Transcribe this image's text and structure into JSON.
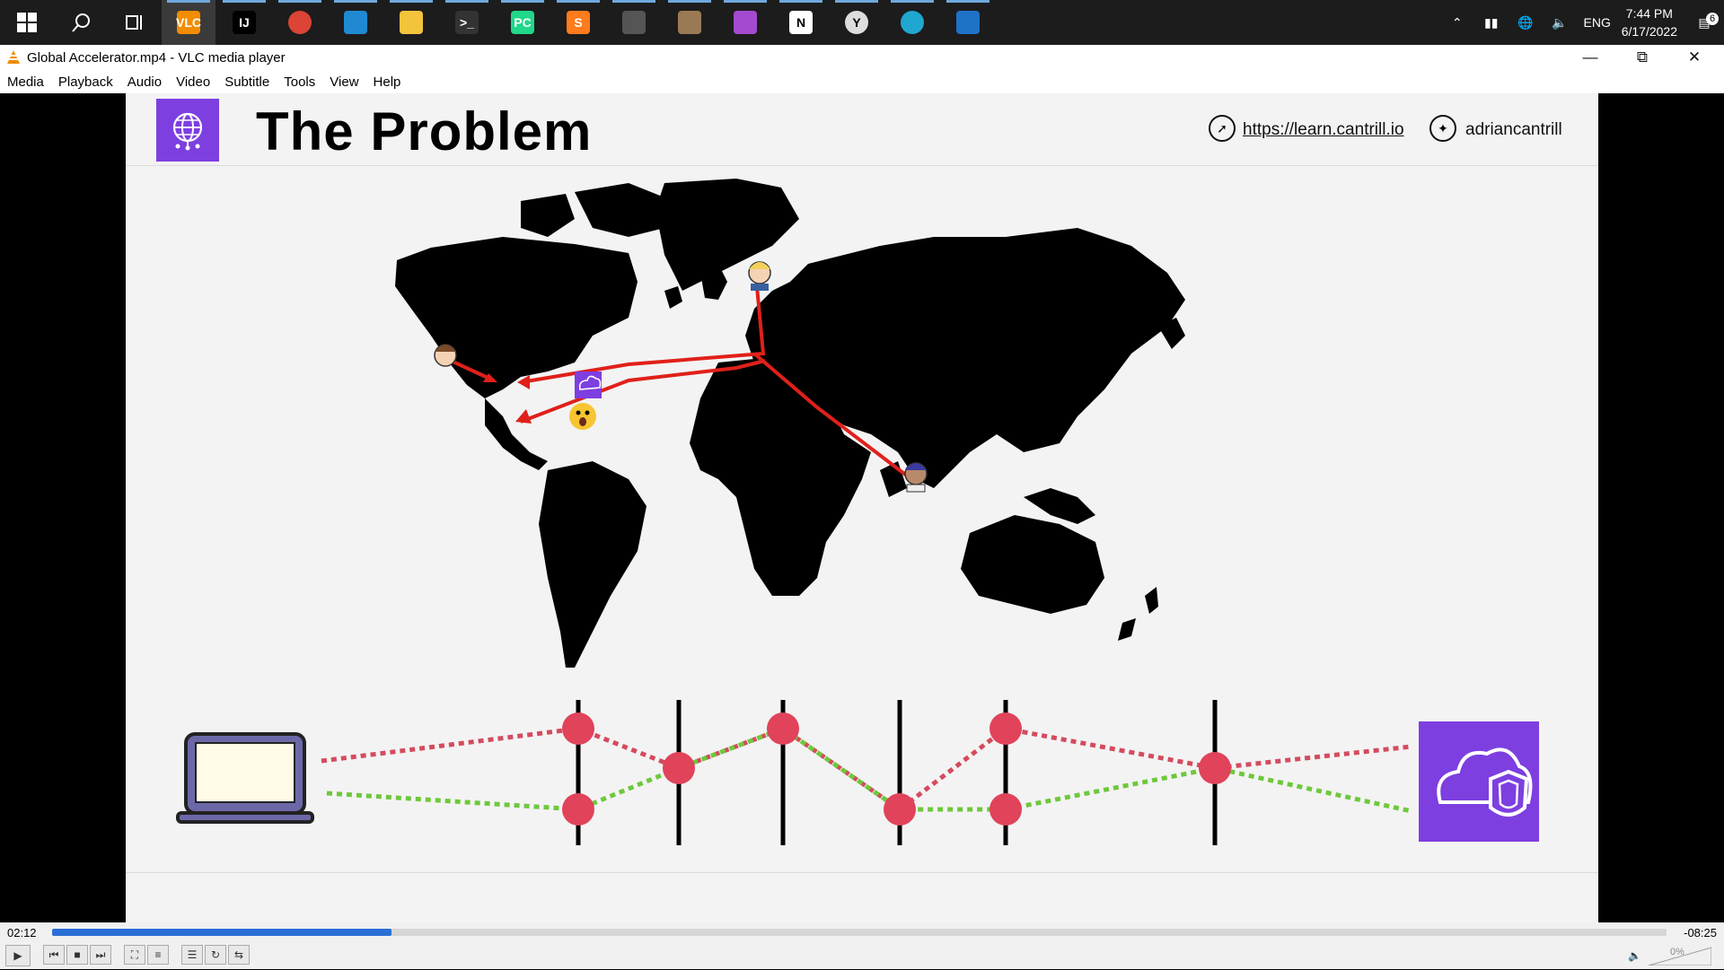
{
  "taskbar": {
    "apps": [
      {
        "name": "vlc",
        "label": "VLC"
      },
      {
        "name": "intellij",
        "label": "IJ"
      },
      {
        "name": "chrome",
        "label": ""
      },
      {
        "name": "vscode",
        "label": ""
      },
      {
        "name": "file-explorer",
        "label": ""
      },
      {
        "name": "terminal",
        "label": ">_"
      },
      {
        "name": "pycharm",
        "label": "PC"
      },
      {
        "name": "sublime",
        "label": "S"
      },
      {
        "name": "security",
        "label": ""
      },
      {
        "name": "app-stack",
        "label": ""
      },
      {
        "name": "app-grid",
        "label": ""
      },
      {
        "name": "notion",
        "label": "N"
      },
      {
        "name": "clock-app",
        "label": "Y"
      },
      {
        "name": "edge",
        "label": ""
      },
      {
        "name": "media-app",
        "label": ""
      }
    ],
    "language": "ENG",
    "time": "7:44 PM",
    "date": "6/17/2022",
    "notifications": "6"
  },
  "window": {
    "title": "Global Accelerator.mp4 - VLC media player"
  },
  "menu": [
    "Media",
    "Playback",
    "Audio",
    "Video",
    "Subtitle",
    "Tools",
    "View",
    "Help"
  ],
  "slide": {
    "title": "The Problem",
    "url": "https://learn.cantrill.io",
    "twitter": "adriancantrill"
  },
  "player": {
    "elapsed": "02:12",
    "remaining": "-08:25",
    "progress": 0.21,
    "volume": "0%"
  },
  "colors": {
    "accent": "#7d3fe0",
    "route": "#e0201a",
    "hop_red": "#e0435a",
    "hop_green": "#6ec83c",
    "seek": "#2a6fd6"
  }
}
